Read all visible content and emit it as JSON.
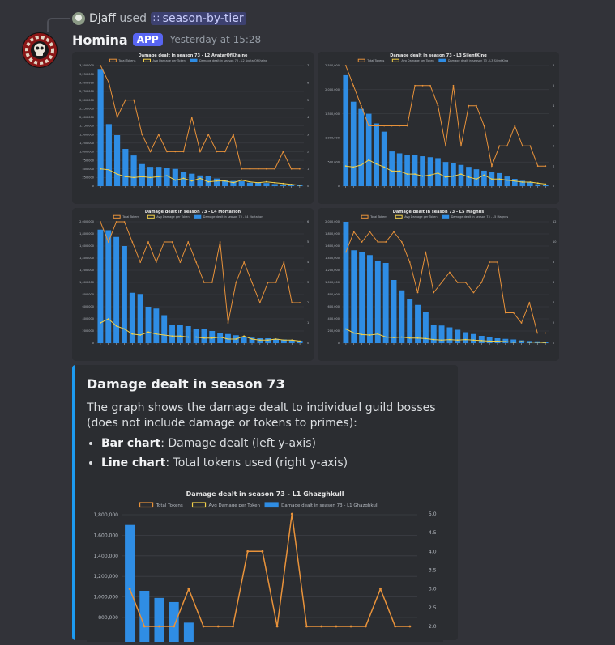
{
  "reply": {
    "user": "Djaff",
    "used_text": "used",
    "command": "season-by-tier"
  },
  "message": {
    "author": "Homina",
    "badge": "APP",
    "timestamp": "Yesterday at 15:28"
  },
  "legend": {
    "total": "Total Tokens",
    "avg": "Avg Damage per Token"
  },
  "colors": {
    "bar": "#2f8de4",
    "total_line": "#e8923a",
    "avg_line": "#f2d04a",
    "grid": "#3d3f45",
    "text": "#b5bac1",
    "embed_accent": "#1d9bf0"
  },
  "embed": {
    "title": "Damage dealt in season 73",
    "description": "The graph shows the damage dealt to individual guild bosses (does not include damage or tokens to primes):",
    "bullets": [
      {
        "bold": "Bar chart",
        "rest": ": Damage dealt (left y-axis)"
      },
      {
        "bold": "Line chart",
        "rest": ": Total tokens used (right y-axis)"
      }
    ]
  },
  "chart_data": [
    {
      "type": "bar",
      "title": "Damage dealt in season 73 - L2 AvatarOfKhaine",
      "series_name": "Damage dealt in season 73 - L2 AvatarOfKhaine",
      "ylim": [
        0,
        3500000
      ],
      "y_step": 250000,
      "y2lim": [
        0,
        7
      ],
      "y2_step": 1,
      "values": [
        3400000,
        1800000,
        1480000,
        1080000,
        890000,
        640000,
        560000,
        560000,
        540000,
        500000,
        400000,
        360000,
        310000,
        290000,
        220000,
        170000,
        150000,
        140000,
        100000,
        95000,
        90000,
        60000,
        50000,
        45000,
        30000
      ],
      "total_tokens": [
        7,
        6,
        4,
        5,
        5,
        3,
        2,
        3,
        2,
        2,
        2,
        4,
        2,
        3,
        2,
        2,
        3,
        1,
        1,
        1,
        1,
        1,
        2,
        1,
        1
      ],
      "avg_damage": [
        1.0,
        0.95,
        0.7,
        0.55,
        0.5,
        0.55,
        0.5,
        0.55,
        0.6,
        0.35,
        0.45,
        0.3,
        0.45,
        0.25,
        0.3,
        0.3,
        0.2,
        0.35,
        0.25,
        0.2,
        0.25,
        0.2,
        0.15,
        0.1,
        0.05
      ]
    },
    {
      "type": "bar",
      "title": "Damage dealt in season 73 - L3 SilentKing",
      "series_name": "Damage dealt in season 73 - L3 SilentKing",
      "ylim": [
        0,
        2500000
      ],
      "y_step": 500000,
      "y2lim": [
        0,
        6
      ],
      "y2_step": 1,
      "values": [
        2300000,
        1750000,
        1600000,
        1500000,
        1300000,
        1130000,
        720000,
        680000,
        650000,
        640000,
        620000,
        600000,
        580000,
        500000,
        480000,
        440000,
        400000,
        350000,
        320000,
        290000,
        270000,
        200000,
        150000,
        110000,
        90000,
        40000,
        20000
      ],
      "total_tokens": [
        6,
        5,
        4,
        3,
        3,
        3,
        3,
        3,
        3,
        5,
        5,
        5,
        4,
        2,
        5,
        2,
        4,
        4,
        3,
        1,
        2,
        2,
        3,
        2,
        2,
        1,
        1
      ],
      "avg_damage": [
        1.0,
        0.95,
        1.05,
        1.3,
        1.1,
        0.95,
        0.75,
        0.75,
        0.6,
        0.6,
        0.5,
        0.55,
        0.65,
        0.45,
        0.5,
        0.6,
        0.45,
        0.35,
        0.55,
        0.35,
        0.35,
        0.3,
        0.25,
        0.2,
        0.2,
        0.15,
        0.1
      ]
    },
    {
      "type": "bar",
      "title": "Damage dealt in season 73 - L4 Mortarion",
      "series_name": "Damage dealt in season 73 - L4 Mortarion",
      "ylim": [
        0,
        2000000
      ],
      "y_step": 200000,
      "y2lim": [
        0,
        6
      ],
      "y2_step": 1,
      "values": [
        1870000,
        1860000,
        1750000,
        1600000,
        830000,
        810000,
        600000,
        570000,
        460000,
        300000,
        300000,
        280000,
        240000,
        240000,
        200000,
        170000,
        150000,
        130000,
        100000,
        90000,
        80000,
        80000,
        70000,
        60000,
        50000,
        40000
      ],
      "total_tokens": [
        6,
        5,
        6,
        6,
        5,
        4,
        5,
        4,
        5,
        5,
        4,
        5,
        4,
        3,
        3,
        5,
        1,
        3,
        4,
        3,
        2,
        3,
        3,
        4,
        2,
        2
      ],
      "avg_damage": [
        1.0,
        1.2,
        0.85,
        0.7,
        0.45,
        0.4,
        0.55,
        0.45,
        0.4,
        0.35,
        0.35,
        0.3,
        0.3,
        0.25,
        0.25,
        0.3,
        0.2,
        0.2,
        0.35,
        0.2,
        0.15,
        0.15,
        0.2,
        0.15,
        0.15,
        0.1
      ]
    },
    {
      "type": "bar",
      "title": "Damage dealt in season 73 - L5 Magnus",
      "series_name": "Damage dealt in season 73 - L5 Magnus",
      "ylim": [
        0,
        2000000
      ],
      "y_step": 200000,
      "y2lim": [
        0,
        12
      ],
      "y2_step": 2,
      "values": [
        2000000,
        1530000,
        1500000,
        1450000,
        1360000,
        1320000,
        1040000,
        870000,
        720000,
        630000,
        520000,
        300000,
        290000,
        260000,
        220000,
        180000,
        150000,
        120000,
        100000,
        80000,
        70000,
        60000,
        45000,
        35000,
        30000,
        20000
      ],
      "total_tokens": [
        9,
        11,
        10,
        11,
        10,
        10,
        11,
        10,
        8,
        5,
        9,
        5,
        6,
        7,
        6,
        6,
        5,
        6,
        8,
        8,
        3,
        3,
        2,
        4,
        1,
        1
      ],
      "avg_damage": [
        1.4,
        1.0,
        0.85,
        0.8,
        0.9,
        0.6,
        0.55,
        0.6,
        0.5,
        0.5,
        0.45,
        0.35,
        0.3,
        0.35,
        0.3,
        0.35,
        0.3,
        0.25,
        0.2,
        0.2,
        0.15,
        0.1,
        0.15,
        0.1,
        0.1,
        0.05
      ]
    },
    {
      "type": "bar",
      "title": "Damage dealt in season 73 - L1 Ghazghkull",
      "series_name": "Damage dealt in season 73 - L1 Ghazghkull",
      "ylim": [
        0,
        1800000
      ],
      "y_step": 200000,
      "y2lim": [
        0,
        5
      ],
      "y2_step": 0.5,
      "yticks_shown": [
        800000,
        1000000,
        1200000,
        1400000,
        1600000,
        1800000
      ],
      "values": [
        1700000,
        1060000,
        990000,
        950000,
        750000,
        400000,
        350000,
        300000,
        250000,
        220000,
        200000,
        180000,
        160000,
        140000,
        120000,
        100000,
        80000,
        60000,
        40000,
        20000
      ],
      "total_tokens": [
        3,
        2,
        2,
        2,
        3,
        2,
        2,
        2,
        4,
        2,
        2,
        5,
        2,
        2,
        2,
        2,
        2,
        3,
        2,
        2
      ],
      "avg_damage": [
        1.2,
        1.0,
        0.9,
        0.9,
        0.8,
        0.7,
        0.6,
        0.5,
        0.5,
        0.4,
        0.4,
        0.3,
        0.3,
        0.3,
        0.2,
        0.2,
        0.2,
        0.1,
        0.1,
        0.1
      ]
    }
  ]
}
